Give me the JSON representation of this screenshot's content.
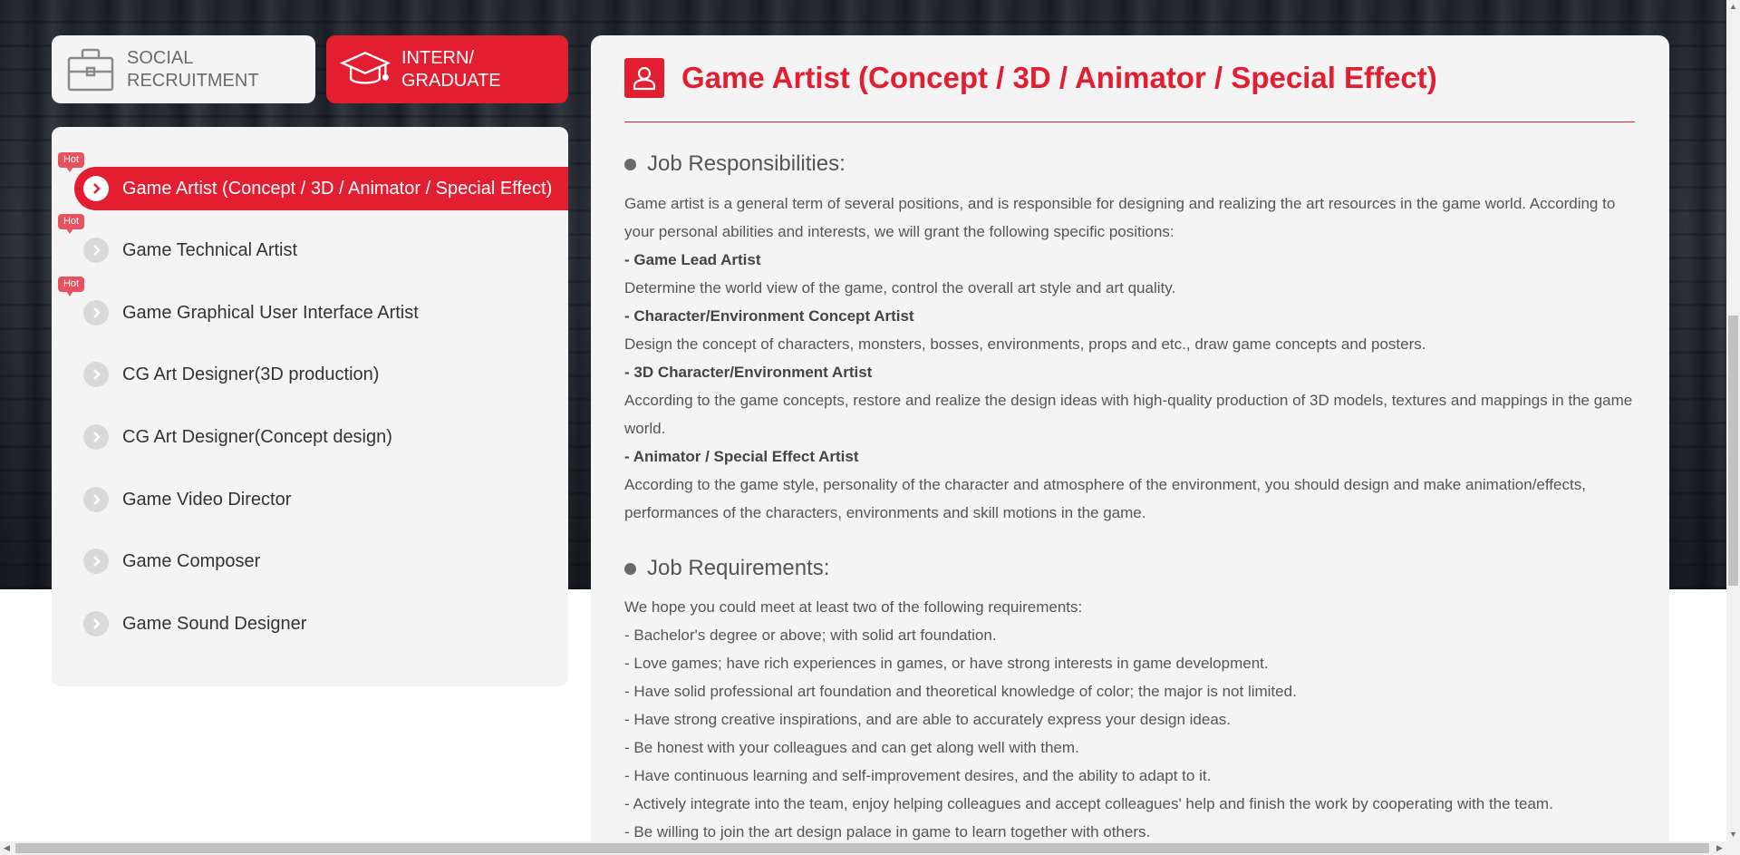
{
  "tabs": {
    "social": {
      "line1": "SOCIAL",
      "line2": "RECRUITMENT",
      "icon": "briefcase-icon"
    },
    "intern": {
      "line1": "INTERN/",
      "line2": "GRADUATE",
      "icon": "graduation-cap-icon"
    }
  },
  "hot_badge": "Hot",
  "jobs": [
    {
      "label": "Game Artist (Concept / 3D / Animator / Special Effect)"
    },
    {
      "label": "Game Technical Artist"
    },
    {
      "label": "Game Graphical User Interface Artist"
    },
    {
      "label": "CG Art Designer(3D production)"
    },
    {
      "label": "CG Art Designer(Concept design)"
    },
    {
      "label": "Game Video Director"
    },
    {
      "label": "Game Composer"
    },
    {
      "label": "Game Sound Designer"
    }
  ],
  "detail": {
    "title": "Game Artist (Concept / 3D / Animator / Special Effect)",
    "title_icon": "person-badge-icon",
    "responsibilities": {
      "heading": "Job Responsibilities:",
      "intro": "Game artist is a general term of several positions, and is responsible for designing and realizing the art resources in the game world. According to your personal abilities and interests, we will grant the following specific positions:",
      "lead_title": "- Game Lead Artist",
      "lead_desc": "Determine the world view of the game, control the overall art style and art quality.",
      "concept_title": "- Character/Environment Concept Artist",
      "concept_desc": "Design the concept of characters, monsters, bosses, environments, props and etc., draw game concepts and posters.",
      "threed_title": "- 3D Character/Environment Artist",
      "threed_desc": "According to the game concepts, restore and realize the design ideas with high-quality production of 3D models, textures and mappings in the game world.",
      "anim_title": "- Animator / Special Effect Artist",
      "anim_desc": "According to the game style, personality of the character and atmosphere of the environment, you should design and make animation/effects, performances of the characters, environments and skill motions in the game."
    },
    "requirements": {
      "heading": "Job Requirements:",
      "intro": "We hope you could meet at least two of the following requirements:",
      "items": [
        "- Bachelor's degree or above; with solid art foundation.",
        "- Love games; have rich experiences in games, or have strong interests in game development.",
        "- Have solid professional art foundation and theoretical knowledge of color; the major is not limited.",
        "- Have strong creative inspirations, and are able to accurately express your design ideas.",
        "- Be honest with your colleagues and can get along well with them.",
        "- Have continuous learning and self-improvement desires, and the ability to adapt to it.",
        "- Actively integrate into the team, enjoy helping colleagues and accept colleagues' help and finish the work by cooperating with the team.",
        "- Be willing to join the art design palace in game to learn together with others."
      ]
    }
  },
  "colors": {
    "accent": "#e31e30",
    "panel": "#f4f4f4",
    "hot": "#e8515e"
  }
}
